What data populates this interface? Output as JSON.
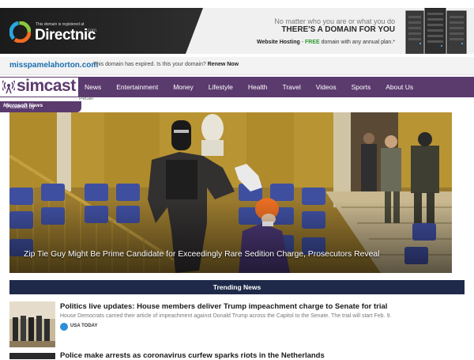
{
  "banner": {
    "registered_note": "This domain is registered at",
    "brand": "Directnic",
    "brand_suffix": ".com",
    "tagline": "No matter who you are or what you do",
    "headline": "THERE'S A DOMAIN FOR YOU",
    "offer_prefix": "Website Hosting",
    "offer_dash": " - ",
    "offer_free": "FREE",
    "offer_rest": " domain with any annual plan.*"
  },
  "domain_bar": {
    "domain": "misspamelahorton.com",
    "message": "This domain has expired. Is this your domain?",
    "link": "Renew Now"
  },
  "site": {
    "logo_text": "simcast",
    "powered_prefix": "Powered by",
    "powered_brand": "Microsoft News",
    "location": "Pecan",
    "nav": [
      "News",
      "Entertainment",
      "Money",
      "Lifestyle",
      "Health",
      "Travel",
      "Videos",
      "Sports",
      "About Us"
    ]
  },
  "hero": {
    "caption": "Zip Tie Guy Might Be Prime Candidate for Exceedingly Rare Sedition Charge, Prosecutors Reveal"
  },
  "trending": {
    "title": "Trending News",
    "articles": [
      {
        "title": "Politics live updates: House members deliver Trump impeachment charge to Senate for trial",
        "summary": "House Democrats carried their article of impeachment against Donald Trump across the Capitol to the Senate. The trial will start Feb. 9.",
        "source": "USA TODAY"
      },
      {
        "title": "Police make arrests as coronavirus curfew sparks riots in the Netherlands"
      }
    ]
  },
  "colors": {
    "nav_purple": "#5b3a6e",
    "trending_bar": "#1f2a4a",
    "domain_link": "#1a6fb0",
    "free_green": "#2f9e2f"
  }
}
